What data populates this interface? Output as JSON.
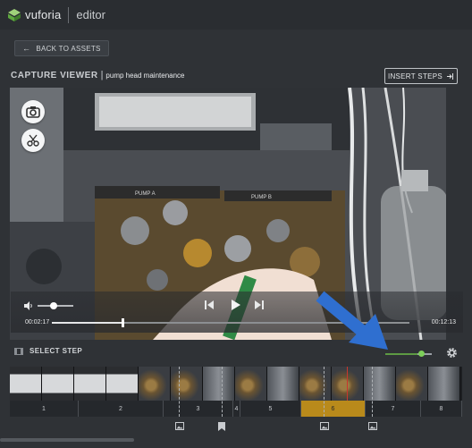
{
  "app": {
    "brand": "vuforia",
    "product": "editor"
  },
  "nav": {
    "back_label": "BACK TO ASSETS",
    "back_icon": "arrow-left-icon"
  },
  "page": {
    "title": "CAPTURE VIEWER",
    "separator": "|",
    "subtitle": "pump head maintenance",
    "insert_label": "INSERT STEPS",
    "insert_icon": "insert-arrow-icon"
  },
  "video": {
    "tools": [
      "camera-icon",
      "scissors-icon"
    ],
    "volume_level": 0.45,
    "current_time": "00:02:17",
    "total_time": "00:12:13",
    "progress": 0.19,
    "labels": {
      "pump_a": "PUMP A",
      "pump_b": "PUMP B"
    }
  },
  "timeline": {
    "select_label": "SELECT STEP",
    "zoom_level": 0.72,
    "steps": [
      {
        "label": "1",
        "active": false
      },
      {
        "label": "2",
        "active": false
      },
      {
        "label": "3",
        "active": false
      },
      {
        "label": "4",
        "active": false
      },
      {
        "label": "5",
        "active": false
      },
      {
        "label": "6",
        "active": true
      },
      {
        "label": "7",
        "active": false
      },
      {
        "label": "8",
        "active": false
      }
    ],
    "annotations": [
      "image-icon",
      "bookmark-icon",
      "image-icon",
      "image-icon"
    ]
  },
  "colors": {
    "accent_green": "#7dcf5a",
    "active_step": "#b98a1b",
    "marker_red": "#c8372d",
    "arrow_blue": "#2f6fd0"
  }
}
